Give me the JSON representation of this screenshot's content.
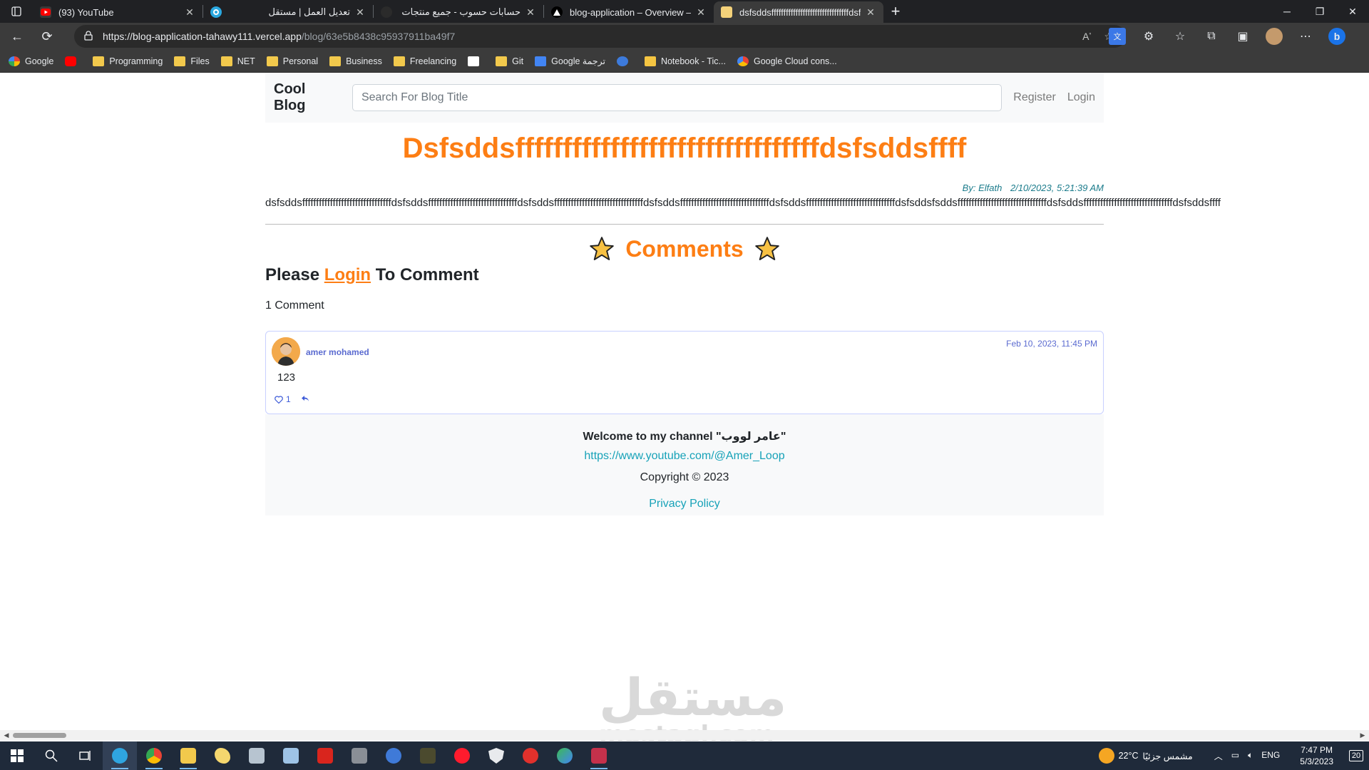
{
  "browser": {
    "tabs": [
      {
        "title": "(93) YouTube",
        "rtl": false,
        "favicon_color": "#ff0000",
        "active": false
      },
      {
        "title": "تعديل العمل | مستقل",
        "rtl": true,
        "favicon_color": "#2aa8e0",
        "active": false
      },
      {
        "title": "حسابات حسوب - جميع منتجات حسوب",
        "rtl": true,
        "favicon_color": "#2b2b2b",
        "active": false
      },
      {
        "title": "blog-application – Overview – Vercel",
        "rtl": false,
        "favicon_color": "#000000",
        "active": false
      },
      {
        "title": "dsfsddsffffffffffffffffffffffffffffffffdsfsddsffff",
        "rtl": false,
        "favicon_color": "#f4d27a",
        "active": true
      }
    ],
    "url_host": "https://blog-application-tahawy111.vercel.app",
    "url_path": "/blog/63e5b8438c95937911ba49f7",
    "bookmarks": [
      {
        "label": "Google",
        "type": "google"
      },
      {
        "label": "",
        "type": "youtube"
      },
      {
        "label": "Programming",
        "type": "folder"
      },
      {
        "label": "Files",
        "type": "folder"
      },
      {
        "label": "NET",
        "type": "folder"
      },
      {
        "label": "Personal",
        "type": "folder"
      },
      {
        "label": "Business",
        "type": "folder"
      },
      {
        "label": "Freelancing",
        "type": "folder"
      },
      {
        "label": "",
        "type": "notion"
      },
      {
        "label": "Git",
        "type": "folder"
      },
      {
        "label": "Google ترجمة",
        "type": "translate"
      },
      {
        "label": "",
        "type": "check"
      },
      {
        "label": "Notebook - Tic...",
        "type": "pen"
      },
      {
        "label": "Google Cloud cons...",
        "type": "cloud"
      }
    ]
  },
  "navbar": {
    "brand": "Cool Blog",
    "search_placeholder": "Search For Blog Title",
    "register": "Register",
    "login": "Login"
  },
  "post": {
    "title": "Dsfsddsffffffffffffffffffffffffffffffffdsfsddsffff",
    "author": "By: Elfath",
    "date": "2/10/2023, 5:21:39 AM",
    "body": "dsfsddsffffffffffffffffffffffffffffffffdsfsddsffffffffffffffffffffffffffffffffdsfsddsffffffffffffffffffffffffffffffffdsfsddsffffffffffffffffffffffffffffffffdsfsddsffffffffffffffffffffffffffffffffdsfsddsfsddsffffffffffffffffffffffffffffffffdsfsddsffffffffffffffffffffffffffffffffdsfsddsffff"
  },
  "comments": {
    "heading": "Comments",
    "login_prefix": "Please",
    "login_link": "Login",
    "login_suffix": "To Comment",
    "count_label": "1 Comment",
    "items": [
      {
        "author": "amer mohamed",
        "date": "Feb 10, 2023, 11:45 PM",
        "text": "123",
        "likes": "1"
      }
    ]
  },
  "footer": {
    "welcome": "Welcome to my channel \"عامر لووب\"",
    "link": "https://www.youtube.com/@Amer_Loop",
    "copyright": "Copyright © 2023",
    "privacy": "Privacy Policy"
  },
  "watermark": {
    "arabic": "مستقل",
    "latin": "mostaql.com"
  },
  "taskbar": {
    "temperature": "22°C",
    "weather_text": "مشمس جزئيًا",
    "language": "ENG",
    "time": "7:47 PM",
    "date": "5/3/2023",
    "notifications": "20"
  },
  "colors": {
    "accent_orange": "#fd7e14",
    "link_teal": "#17a2b8",
    "comment_blue": "#5b6bd0"
  }
}
